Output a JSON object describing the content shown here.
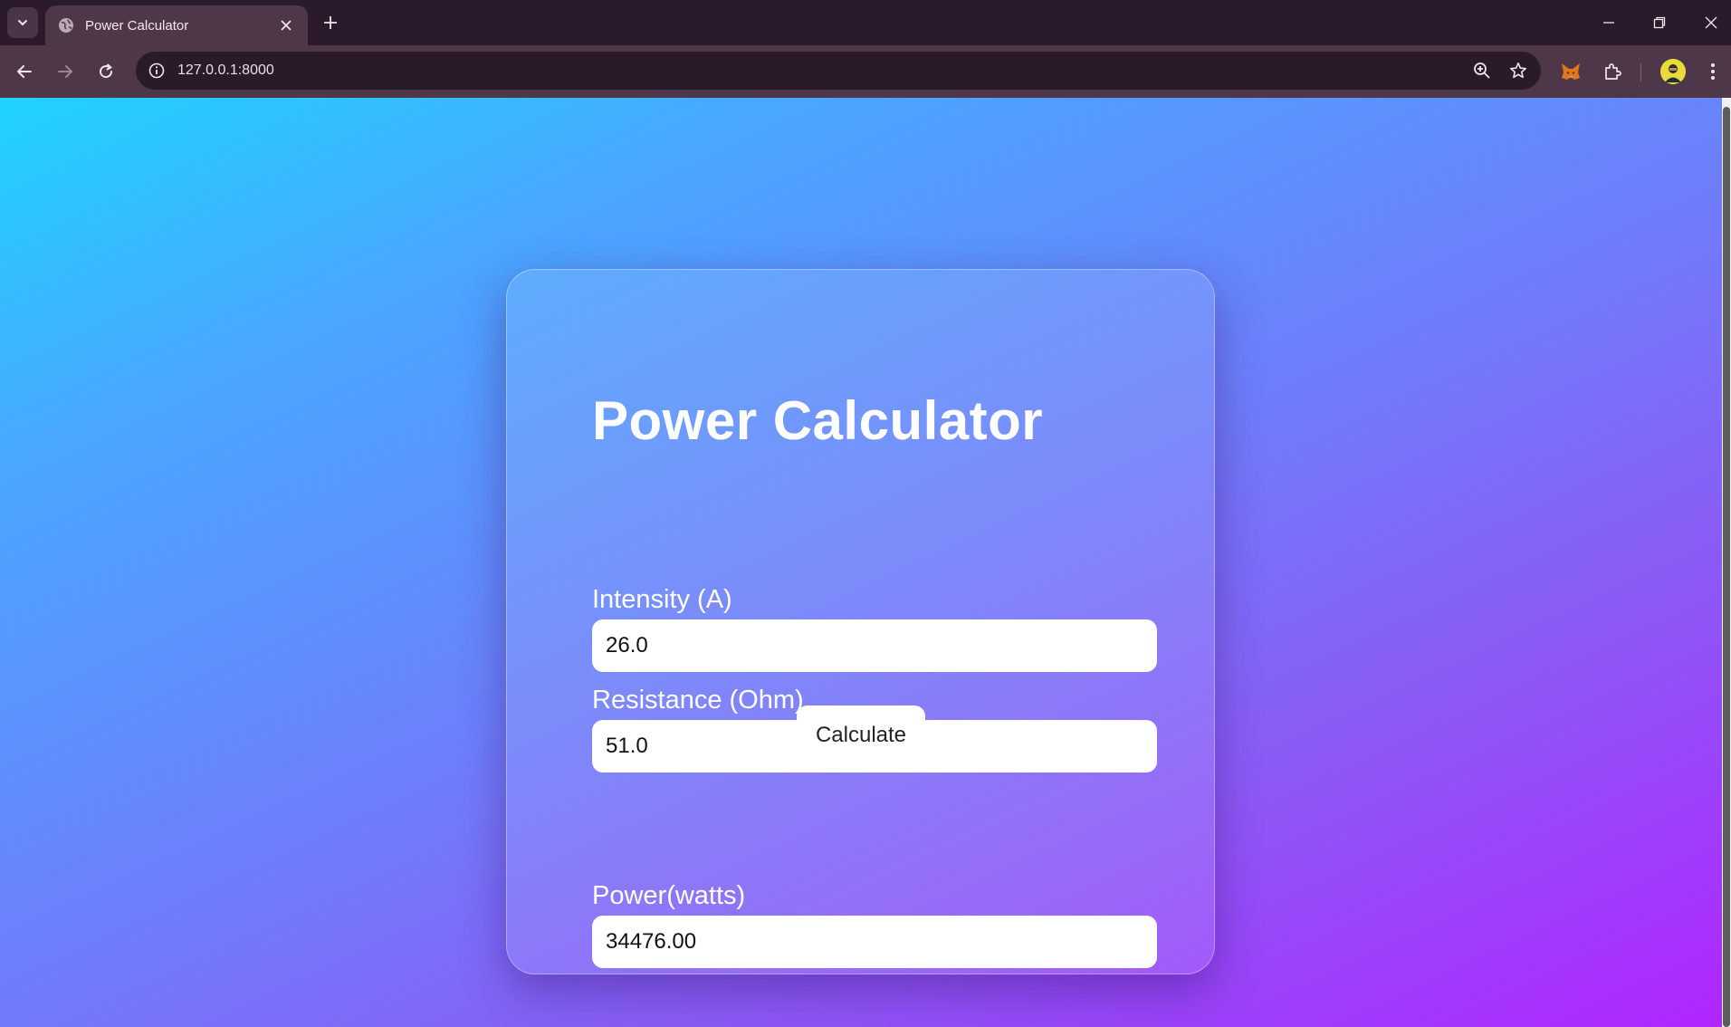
{
  "browser": {
    "tab_title": "Power Calculator",
    "url": "127.0.0.1:8000"
  },
  "page": {
    "title": "Power Calculator",
    "intensity": {
      "label": "Intensity (A)",
      "value": "26.0"
    },
    "resistance": {
      "label": "Resistance (Ohm)",
      "value": "51.0"
    },
    "calculate_label": "Calculate",
    "power": {
      "label": "Power(watts)",
      "value": "34476.00"
    }
  },
  "colors": {
    "gradient_start": "#1fd3ff",
    "gradient_end": "#b026ff",
    "chrome_dark": "#2a1a2b",
    "chrome_toolbar": "#4e3749"
  }
}
